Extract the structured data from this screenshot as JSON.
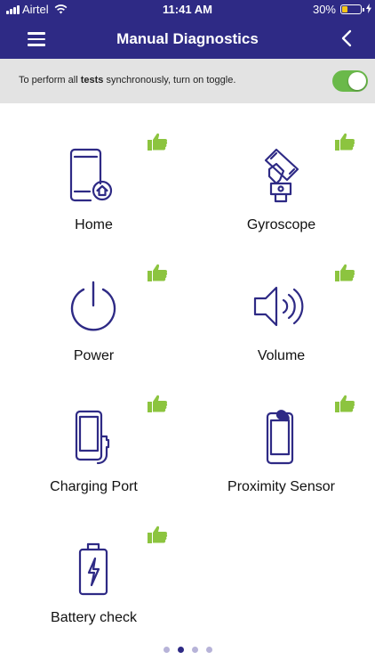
{
  "status_bar": {
    "carrier": "Airtel",
    "time": "11:41 AM",
    "battery_percent": "30%",
    "battery_level": 0.3
  },
  "header": {
    "title": "Manual Diagnostics",
    "menu_icon": "hamburger-menu-icon",
    "back_icon": "chevron-left-icon"
  },
  "banner": {
    "text_before": "To perform all ",
    "text_bold": "tests",
    "text_after": " synchronously, turn on toggle.",
    "toggle_on": true
  },
  "tests": [
    {
      "label": "Home",
      "icon": "phone-home-icon",
      "status_icon": "thumbs-up-icon"
    },
    {
      "label": "Gyroscope",
      "icon": "gyroscope-icon",
      "status_icon": "thumbs-up-icon"
    },
    {
      "label": "Power",
      "icon": "power-icon",
      "status_icon": "thumbs-up-icon"
    },
    {
      "label": "Volume",
      "icon": "volume-icon",
      "status_icon": "thumbs-up-icon"
    },
    {
      "label": "Charging Port",
      "icon": "charging-phone-icon",
      "status_icon": "thumbs-up-icon"
    },
    {
      "label": "Proximity Sensor",
      "icon": "proximity-sensor-icon",
      "status_icon": "thumbs-up-icon"
    },
    {
      "label": "Battery check",
      "icon": "battery-charge-icon",
      "status_icon": "thumbs-up-icon"
    }
  ],
  "pagination": {
    "total_pages": 4,
    "current_page": 2
  },
  "colors": {
    "primary": "#2e2a85",
    "banner_bg": "#e3e3e3",
    "toggle_on": "#6ab94a",
    "thumbs_up": "#8cc43f",
    "icon_stroke": "#2e2a85"
  }
}
